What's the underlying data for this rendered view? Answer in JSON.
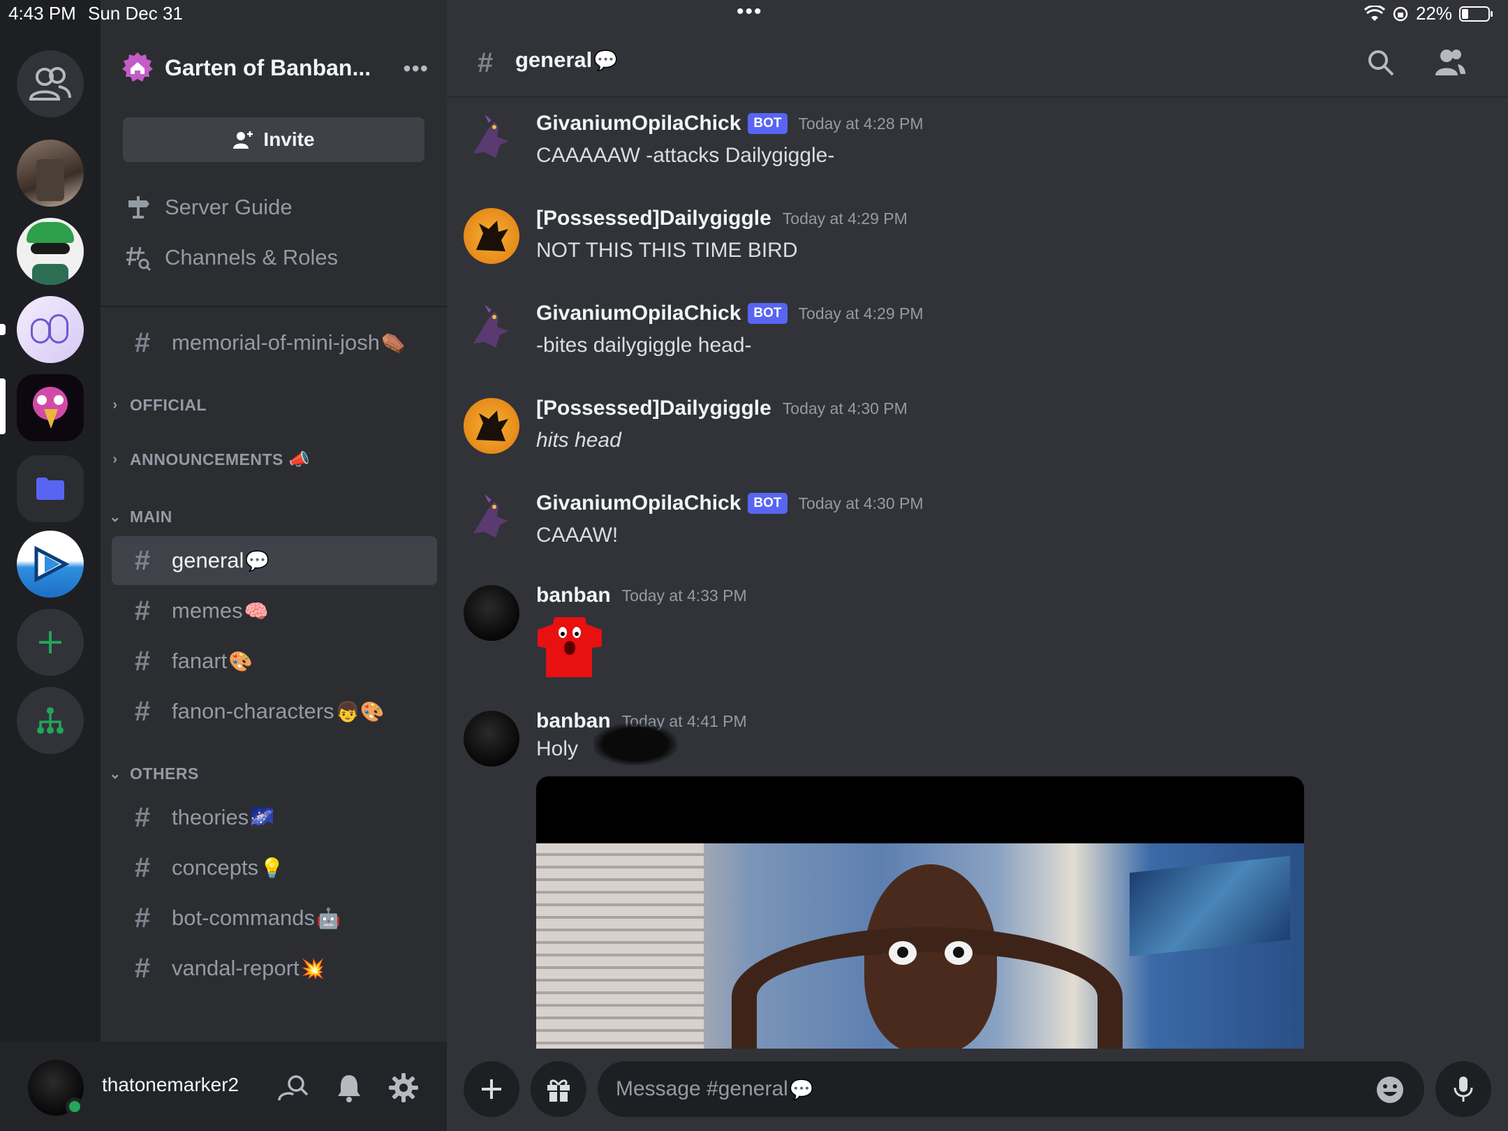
{
  "status_bar": {
    "time": "4:43 PM",
    "date": "Sun Dec 31",
    "battery": "22%"
  },
  "colors": {
    "blurple": "#5865f2",
    "online": "#23a55a",
    "green_action": "#23a55a"
  },
  "server_rail": {
    "items": [
      {
        "name": "direct-messages",
        "icon": "people-icon"
      },
      {
        "name": "server-1",
        "icon": "photo-avatar"
      },
      {
        "name": "server-2",
        "icon": "cartoon-avatar"
      },
      {
        "name": "server-3",
        "icon": "mascot-avatar"
      },
      {
        "name": "server-4-active",
        "icon": "bird-avatar"
      },
      {
        "name": "folder",
        "icon": "folder-icon"
      },
      {
        "name": "server-5",
        "icon": "play-avatar"
      },
      {
        "name": "add-server",
        "icon": "plus-icon"
      },
      {
        "name": "discover",
        "icon": "hub-icon"
      }
    ]
  },
  "guild": {
    "name": "Garten of Banban...",
    "invite_label": "Invite",
    "nav": [
      {
        "label": "Server Guide",
        "icon": "signpost-icon"
      },
      {
        "label": "Channels & Roles",
        "icon": "channel-browse-icon"
      }
    ],
    "pinned_channel": {
      "name": "memorial-of-mini-josh",
      "emoji": "⚰️"
    },
    "categories": [
      {
        "label": "OFFICIAL",
        "emoji": "",
        "expanded": false
      },
      {
        "label": "ANNOUNCEMENTS",
        "emoji": "📣",
        "expanded": false
      },
      {
        "label": "MAIN",
        "emoji": "",
        "expanded": true
      },
      {
        "label": "OTHERS",
        "emoji": "",
        "expanded": true
      }
    ],
    "main_channels": [
      {
        "name": "general",
        "emoji": "💬",
        "active": true
      },
      {
        "name": "memes",
        "emoji": "🧠",
        "active": false
      },
      {
        "name": "fanart",
        "emoji": "🎨",
        "active": false
      },
      {
        "name": "fanon-characters",
        "emoji": "👦🎨",
        "active": false
      }
    ],
    "other_channels": [
      {
        "name": "theories",
        "emoji": "🌌"
      },
      {
        "name": "concepts",
        "emoji": "💡"
      },
      {
        "name": "bot-commands",
        "emoji": "🤖"
      },
      {
        "name": "vandal-report",
        "emoji": "💥"
      }
    ]
  },
  "user": {
    "name": "thatonemarker2",
    "status": "online"
  },
  "channel_header": {
    "hash": "#",
    "name": "general",
    "emoji": "💬"
  },
  "messages": [
    {
      "author": "GivaniumOpilaChick",
      "bot": true,
      "bot_label": "BOT",
      "time": "Today at 4:28 PM",
      "text": "CAAAAAW -attacks Dailygiggle-"
    },
    {
      "author": "[Possessed]Dailygiggle",
      "bot": false,
      "time": "Today at 4:29 PM",
      "text": "NOT THIS THIS TIME BIRD"
    },
    {
      "author": "GivaniumOpilaChick",
      "bot": true,
      "bot_label": "BOT",
      "time": "Today at 4:29 PM",
      "text": "-bites dailygiggle head-"
    },
    {
      "author": "[Possessed]Dailygiggle",
      "bot": false,
      "time": "Today at 4:30 PM",
      "text": "hits head"
    },
    {
      "author": "GivaniumOpilaChick",
      "bot": true,
      "bot_label": "BOT",
      "time": "Today at 4:30 PM",
      "text": "CAAAW!"
    },
    {
      "author": "banban",
      "bot": false,
      "time": "Today at 4:33 PM",
      "text": ""
    },
    {
      "author": "banban",
      "bot": false,
      "time": "Today at 4:41 PM",
      "text": "Holy"
    }
  ],
  "composer": {
    "placeholder": "Message #general",
    "emoji": "💬"
  }
}
